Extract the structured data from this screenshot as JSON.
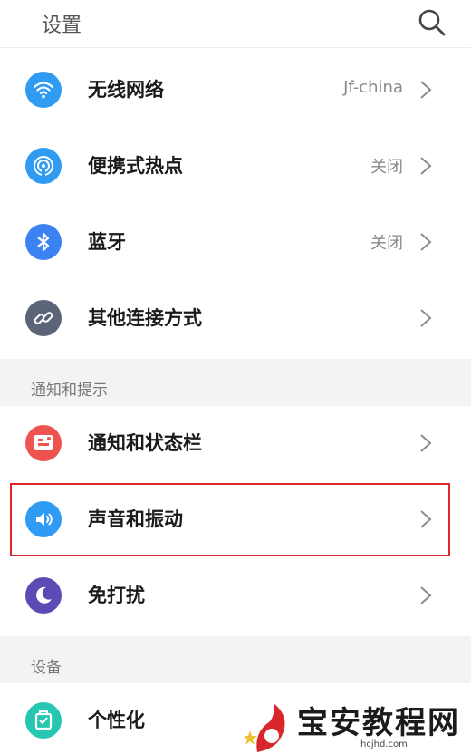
{
  "header": {
    "title": "设置",
    "search_icon": "search-icon"
  },
  "rows_top": [
    {
      "label": "无线网络",
      "value": "Jf-china",
      "icon": "wifi-icon",
      "color": "#2f9bf3"
    },
    {
      "label": "便携式热点",
      "value": "关闭",
      "icon": "hotspot-icon",
      "color": "#2f9bf3"
    },
    {
      "label": "蓝牙",
      "value": "关闭",
      "icon": "bluetooth-icon",
      "color": "#3b82f2"
    },
    {
      "label": "其他连接方式",
      "value": "",
      "icon": "link-icon",
      "color": "#5b6577"
    }
  ],
  "section_notify": {
    "title": "通知和提示"
  },
  "rows_notify": [
    {
      "label": "通知和状态栏",
      "value": "",
      "icon": "notification-icon",
      "color": "#ef5350"
    },
    {
      "label": "声音和振动",
      "value": "",
      "icon": "speaker-icon",
      "color": "#2f9bf3"
    },
    {
      "label": "免打扰",
      "value": "",
      "icon": "moon-icon",
      "color": "#5c4bb5"
    }
  ],
  "section_device": {
    "title": "设备"
  },
  "rows_device": [
    {
      "label": "个性化",
      "value": "",
      "icon": "personalize-icon",
      "color": "#26c6b0"
    }
  ],
  "watermark": {
    "text": "宝安教程网",
    "url": "hcjhd.com"
  }
}
